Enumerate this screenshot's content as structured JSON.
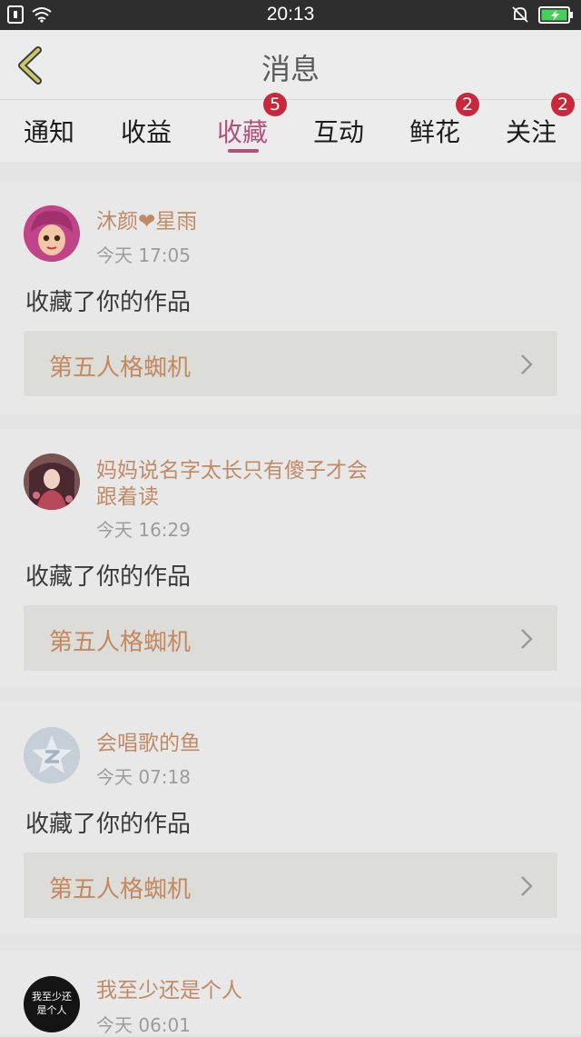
{
  "status_bar": {
    "time": "20:13"
  },
  "header": {
    "title": "消息"
  },
  "tabs": [
    {
      "label": "通知",
      "badge": ""
    },
    {
      "label": "收益",
      "badge": ""
    },
    {
      "label": "收藏",
      "badge": "5"
    },
    {
      "label": "互动",
      "badge": ""
    },
    {
      "label": "鲜花",
      "badge": "2"
    },
    {
      "label": "关注",
      "badge": "2"
    }
  ],
  "messages": [
    {
      "user": "沐颜❤星雨",
      "time": "今天 17:05",
      "action": "收藏了你的作品",
      "work": "第五人格蜘机"
    },
    {
      "user": "妈妈说名字太长只有傻子才会跟着读",
      "time": "今天 16:29",
      "action": "收藏了你的作品",
      "work": "第五人格蜘机"
    },
    {
      "user": "会唱歌的鱼",
      "time": "今天 07:18",
      "action": "收藏了你的作品",
      "work": "第五人格蜘机"
    },
    {
      "user": "我至少还是个人",
      "time": "今天 06:01",
      "avatar_text": "我至少还是个人"
    }
  ],
  "colors": {
    "accent": "#b4507c",
    "badge": "#c9273b",
    "link": "#c08a66"
  }
}
